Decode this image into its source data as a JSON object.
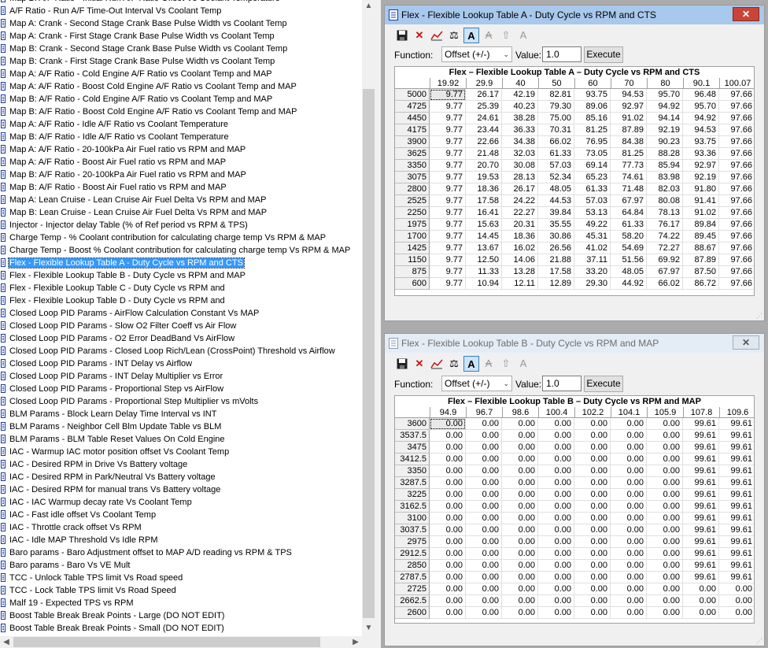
{
  "list": {
    "items": [
      "Map B: A/F Ratio - Initial Run A/F Ratio Offset Vs Coolant Temperature",
      "A/F Ratio - Run A/F Time-Out Interval Vs Coolant Temp",
      "Map A: Crank - Second Stage Crank Base Pulse Width vs Coolant Temp",
      "Map A: Crank - First Stage Crank Base Pulse Width vs Coolant Temp",
      "Map B: Crank - Second Stage Crank Base Pulse Width vs Coolant Temp",
      "Map B: Crank - First Stage Crank Base Pulse Width vs Coolant Temp",
      "Map A: A/F Ratio - Cold Engine A/F Ratio vs Coolant Temp and MAP",
      "Map A: A/F Ratio - Boost Cold Engine A/F Ratio vs Coolant Temp and MAP",
      "Map B: A/F Ratio - Cold Engine A/F Ratio vs Coolant Temp and MAP",
      "Map B: A/F Ratio - Boost Cold Engine A/F Ratio vs Coolant Temp and MAP",
      "Map A: A/F Ratio - Idle A/F Ratio vs Coolant Temperature",
      "Map B: A/F Ratio - Idle A/F Ratio vs Coolant Temperature",
      "Map A: A/F Ratio - 20-100kPa Air Fuel ratio vs RPM and MAP",
      "Map A: A/F Ratio - Boost Air Fuel ratio vs RPM and MAP",
      "Map B: A/F Ratio - 20-100kPa Air Fuel ratio vs RPM and MAP",
      "Map B: A/F Ratio - Boost Air Fuel ratio vs RPM and MAP",
      "Map A: Lean Cruise - Lean Cruise Air Fuel Delta Vs RPM and MAP",
      "Map B: Lean Cruise - Lean Cruise Air Fuel Delta Vs RPM and MAP",
      "Injector - Injector delay Table (% of Ref period vs RPM & TPS)",
      "Charge Temp - % Coolant contribution for calculating charge temp Vs RPM & MAP",
      "Charge Temp - Boost % Coolant contribution for calculating charge temp Vs RPM & MAP",
      "Flex - Flexible Lookup Table A - Duty Cycle vs RPM and CTS",
      "Flex - Flexible Lookup Table B - Duty Cycle vs RPM and MAP",
      "Flex - Flexible Lookup Table C - Duty Cycle vs RPM and",
      "Flex - Flexible Lookup Table D - Duty Cycle vs RPM and",
      "Closed Loop PID Params - AirFlow Calculation Constant Vs MAP",
      "Closed Loop PID Params - Slow O2 Filter Coeff vs Air Flow",
      "Closed Loop PID Params - O2 Error DeadBand Vs AirFlow",
      "Closed Loop PID Params - Closed Loop Rich/Lean (CrossPoint) Threshold vs Airflow",
      "Closed Loop PID Params - INT Delay vs Airflow",
      "Closed Loop PID Params - INT Delay Multiplier vs Error",
      "Closed Loop PID Params - Proportional Step vs AirFlow",
      "Closed Loop PID Params - Proportional Step Multiplier vs mVolts",
      "BLM Params - Block Learn Delay Time Interval vs INT",
      "BLM Params - Neighbor Cell Blm Update Table  vs BLM",
      "BLM Params - BLM Table Reset Values On Cold Engine",
      "IAC - Warmup IAC motor position offset Vs  Coolant Temp",
      "IAC - Desired RPM in Drive Vs Battery voltage",
      "IAC - Desired RPM in Park/Neutral Vs Battery voltage",
      "IAC - Desired RPM for manual trans Vs Battery voltage",
      "IAC - IAC Warmup decay rate Vs Coolant Temp",
      "IAC - Fast idle offset Vs Coolant Temp",
      "IAC - Throttle crack offset Vs RPM",
      "IAC - Idle MAP Threshold Vs Idle RPM",
      "Baro params - Baro Adjustment offset to MAP A/D reading vs RPM & TPS",
      "Baro params - Baro Vs VE Mult",
      "TCC - Unlock Table  TPS limit Vs Road speed",
      "TCC - Lock Table TPS limit Vs Road Speed",
      "Malf 19 - Expected TPS vs RPM",
      "Boost Table Break Break Points - Large (DO NOT EDIT)",
      "Boost Table Break Break Points - Small (DO NOT EDIT)"
    ],
    "selected_index": 21
  },
  "window_a": {
    "title": "Flex - Flexible Lookup Table A - Duty Cycle vs RPM and CTS",
    "close_label": "✕",
    "function_label": "Function:",
    "function_value": "Offset (+/-)",
    "value_label": "Value:",
    "value_input": "1.0",
    "execute_label": "Execute",
    "table_title": "Flex – Flexible Lookup Table A – Duty Cycle vs RPM and CTS",
    "columns": [
      "19.92",
      "29.9",
      "40",
      "50",
      "60",
      "70",
      "80",
      "90.1",
      "100.07"
    ],
    "rows": [
      {
        "rpm": "5000",
        "vals": [
          "9.77",
          "26.17",
          "42.19",
          "82.81",
          "93.75",
          "94.53",
          "95.70",
          "96.48",
          "97.66"
        ]
      },
      {
        "rpm": "4725",
        "vals": [
          "9.77",
          "25.39",
          "40.23",
          "79.30",
          "89.06",
          "92.97",
          "94.92",
          "95.70",
          "97.66"
        ]
      },
      {
        "rpm": "4450",
        "vals": [
          "9.77",
          "24.61",
          "38.28",
          "75.00",
          "85.16",
          "91.02",
          "94.14",
          "94.92",
          "97.66"
        ]
      },
      {
        "rpm": "4175",
        "vals": [
          "9.77",
          "23.44",
          "36.33",
          "70.31",
          "81.25",
          "87.89",
          "92.19",
          "94.53",
          "97.66"
        ]
      },
      {
        "rpm": "3900",
        "vals": [
          "9.77",
          "22.66",
          "34.38",
          "66.02",
          "76.95",
          "84.38",
          "90.23",
          "93.75",
          "97.66"
        ]
      },
      {
        "rpm": "3625",
        "vals": [
          "9.77",
          "21.48",
          "32.03",
          "61.33",
          "73.05",
          "81.25",
          "88.28",
          "93.36",
          "97.66"
        ]
      },
      {
        "rpm": "3350",
        "vals": [
          "9.77",
          "20.70",
          "30.08",
          "57.03",
          "69.14",
          "77.73",
          "85.94",
          "92.97",
          "97.66"
        ]
      },
      {
        "rpm": "3075",
        "vals": [
          "9.77",
          "19.53",
          "28.13",
          "52.34",
          "65.23",
          "74.61",
          "83.98",
          "92.19",
          "97.66"
        ]
      },
      {
        "rpm": "2800",
        "vals": [
          "9.77",
          "18.36",
          "26.17",
          "48.05",
          "61.33",
          "71.48",
          "82.03",
          "91.80",
          "97.66"
        ]
      },
      {
        "rpm": "2525",
        "vals": [
          "9.77",
          "17.58",
          "24.22",
          "44.53",
          "57.03",
          "67.97",
          "80.08",
          "91.41",
          "97.66"
        ]
      },
      {
        "rpm": "2250",
        "vals": [
          "9.77",
          "16.41",
          "22.27",
          "39.84",
          "53.13",
          "64.84",
          "78.13",
          "91.02",
          "97.66"
        ]
      },
      {
        "rpm": "1975",
        "vals": [
          "9.77",
          "15.63",
          "20.31",
          "35.55",
          "49.22",
          "61.33",
          "76.17",
          "89.84",
          "97.66"
        ]
      },
      {
        "rpm": "1700",
        "vals": [
          "9.77",
          "14.45",
          "18.36",
          "30.86",
          "45.31",
          "58.20",
          "74.22",
          "89.45",
          "97.66"
        ]
      },
      {
        "rpm": "1425",
        "vals": [
          "9.77",
          "13.67",
          "16.02",
          "26.56",
          "41.02",
          "54.69",
          "72.27",
          "88.67",
          "97.66"
        ]
      },
      {
        "rpm": "1150",
        "vals": [
          "9.77",
          "12.50",
          "14.06",
          "21.88",
          "37.11",
          "51.56",
          "69.92",
          "87.89",
          "97.66"
        ]
      },
      {
        "rpm": "875",
        "vals": [
          "9.77",
          "11.33",
          "13.28",
          "17.58",
          "33.20",
          "48.05",
          "67.97",
          "87.50",
          "97.66"
        ]
      },
      {
        "rpm": "600",
        "vals": [
          "9.77",
          "10.94",
          "12.11",
          "12.89",
          "29.30",
          "44.92",
          "66.02",
          "86.72",
          "97.66"
        ]
      }
    ]
  },
  "window_b": {
    "title": "Flex - Flexible Lookup Table B - Duty Cycle vs RPM and MAP",
    "close_label": "✕",
    "function_label": "Function:",
    "function_value": "Offset (+/-)",
    "value_label": "Value:",
    "value_input": "1.0",
    "execute_label": "Execute",
    "table_title": "Flex – Flexible Lookup Table B – Duty Cycle vs RPM and MAP",
    "columns": [
      "94.9",
      "96.7",
      "98.6",
      "100.4",
      "102.2",
      "104.1",
      "105.9",
      "107.8",
      "109.6"
    ],
    "rows": [
      {
        "rpm": "3600",
        "vals": [
          "0.00",
          "0.00",
          "0.00",
          "0.00",
          "0.00",
          "0.00",
          "0.00",
          "99.61",
          "99.61"
        ]
      },
      {
        "rpm": "3537.5",
        "vals": [
          "0.00",
          "0.00",
          "0.00",
          "0.00",
          "0.00",
          "0.00",
          "0.00",
          "99.61",
          "99.61"
        ]
      },
      {
        "rpm": "3475",
        "vals": [
          "0.00",
          "0.00",
          "0.00",
          "0.00",
          "0.00",
          "0.00",
          "0.00",
          "99.61",
          "99.61"
        ]
      },
      {
        "rpm": "3412.5",
        "vals": [
          "0.00",
          "0.00",
          "0.00",
          "0.00",
          "0.00",
          "0.00",
          "0.00",
          "99.61",
          "99.61"
        ]
      },
      {
        "rpm": "3350",
        "vals": [
          "0.00",
          "0.00",
          "0.00",
          "0.00",
          "0.00",
          "0.00",
          "0.00",
          "99.61",
          "99.61"
        ]
      },
      {
        "rpm": "3287.5",
        "vals": [
          "0.00",
          "0.00",
          "0.00",
          "0.00",
          "0.00",
          "0.00",
          "0.00",
          "99.61",
          "99.61"
        ]
      },
      {
        "rpm": "3225",
        "vals": [
          "0.00",
          "0.00",
          "0.00",
          "0.00",
          "0.00",
          "0.00",
          "0.00",
          "99.61",
          "99.61"
        ]
      },
      {
        "rpm": "3162.5",
        "vals": [
          "0.00",
          "0.00",
          "0.00",
          "0.00",
          "0.00",
          "0.00",
          "0.00",
          "99.61",
          "99.61"
        ]
      },
      {
        "rpm": "3100",
        "vals": [
          "0.00",
          "0.00",
          "0.00",
          "0.00",
          "0.00",
          "0.00",
          "0.00",
          "99.61",
          "99.61"
        ]
      },
      {
        "rpm": "3037.5",
        "vals": [
          "0.00",
          "0.00",
          "0.00",
          "0.00",
          "0.00",
          "0.00",
          "0.00",
          "99.61",
          "99.61"
        ]
      },
      {
        "rpm": "2975",
        "vals": [
          "0.00",
          "0.00",
          "0.00",
          "0.00",
          "0.00",
          "0.00",
          "0.00",
          "99.61",
          "99.61"
        ]
      },
      {
        "rpm": "2912.5",
        "vals": [
          "0.00",
          "0.00",
          "0.00",
          "0.00",
          "0.00",
          "0.00",
          "0.00",
          "99.61",
          "99.61"
        ]
      },
      {
        "rpm": "2850",
        "vals": [
          "0.00",
          "0.00",
          "0.00",
          "0.00",
          "0.00",
          "0.00",
          "0.00",
          "99.61",
          "99.61"
        ]
      },
      {
        "rpm": "2787.5",
        "vals": [
          "0.00",
          "0.00",
          "0.00",
          "0.00",
          "0.00",
          "0.00",
          "0.00",
          "99.61",
          "99.61"
        ]
      },
      {
        "rpm": "2725",
        "vals": [
          "0.00",
          "0.00",
          "0.00",
          "0.00",
          "0.00",
          "0.00",
          "0.00",
          "0.00",
          "0.00"
        ]
      },
      {
        "rpm": "2662.5",
        "vals": [
          "0.00",
          "0.00",
          "0.00",
          "0.00",
          "0.00",
          "0.00",
          "0.00",
          "0.00",
          "0.00"
        ]
      },
      {
        "rpm": "2600",
        "vals": [
          "0.00",
          "0.00",
          "0.00",
          "0.00",
          "0.00",
          "0.00",
          "0.00",
          "0.00",
          "0.00"
        ]
      }
    ]
  },
  "icons": {
    "save": "save-icon",
    "delete": "delete-icon",
    "graph": "graph-icon",
    "balance": "balance-icon",
    "font_a_pressed": "font-a-icon",
    "font_a_cross": "font-a-strike-icon",
    "font_a_up": "font-a-up-icon",
    "font_a_plain": "font-a-plain-icon"
  }
}
